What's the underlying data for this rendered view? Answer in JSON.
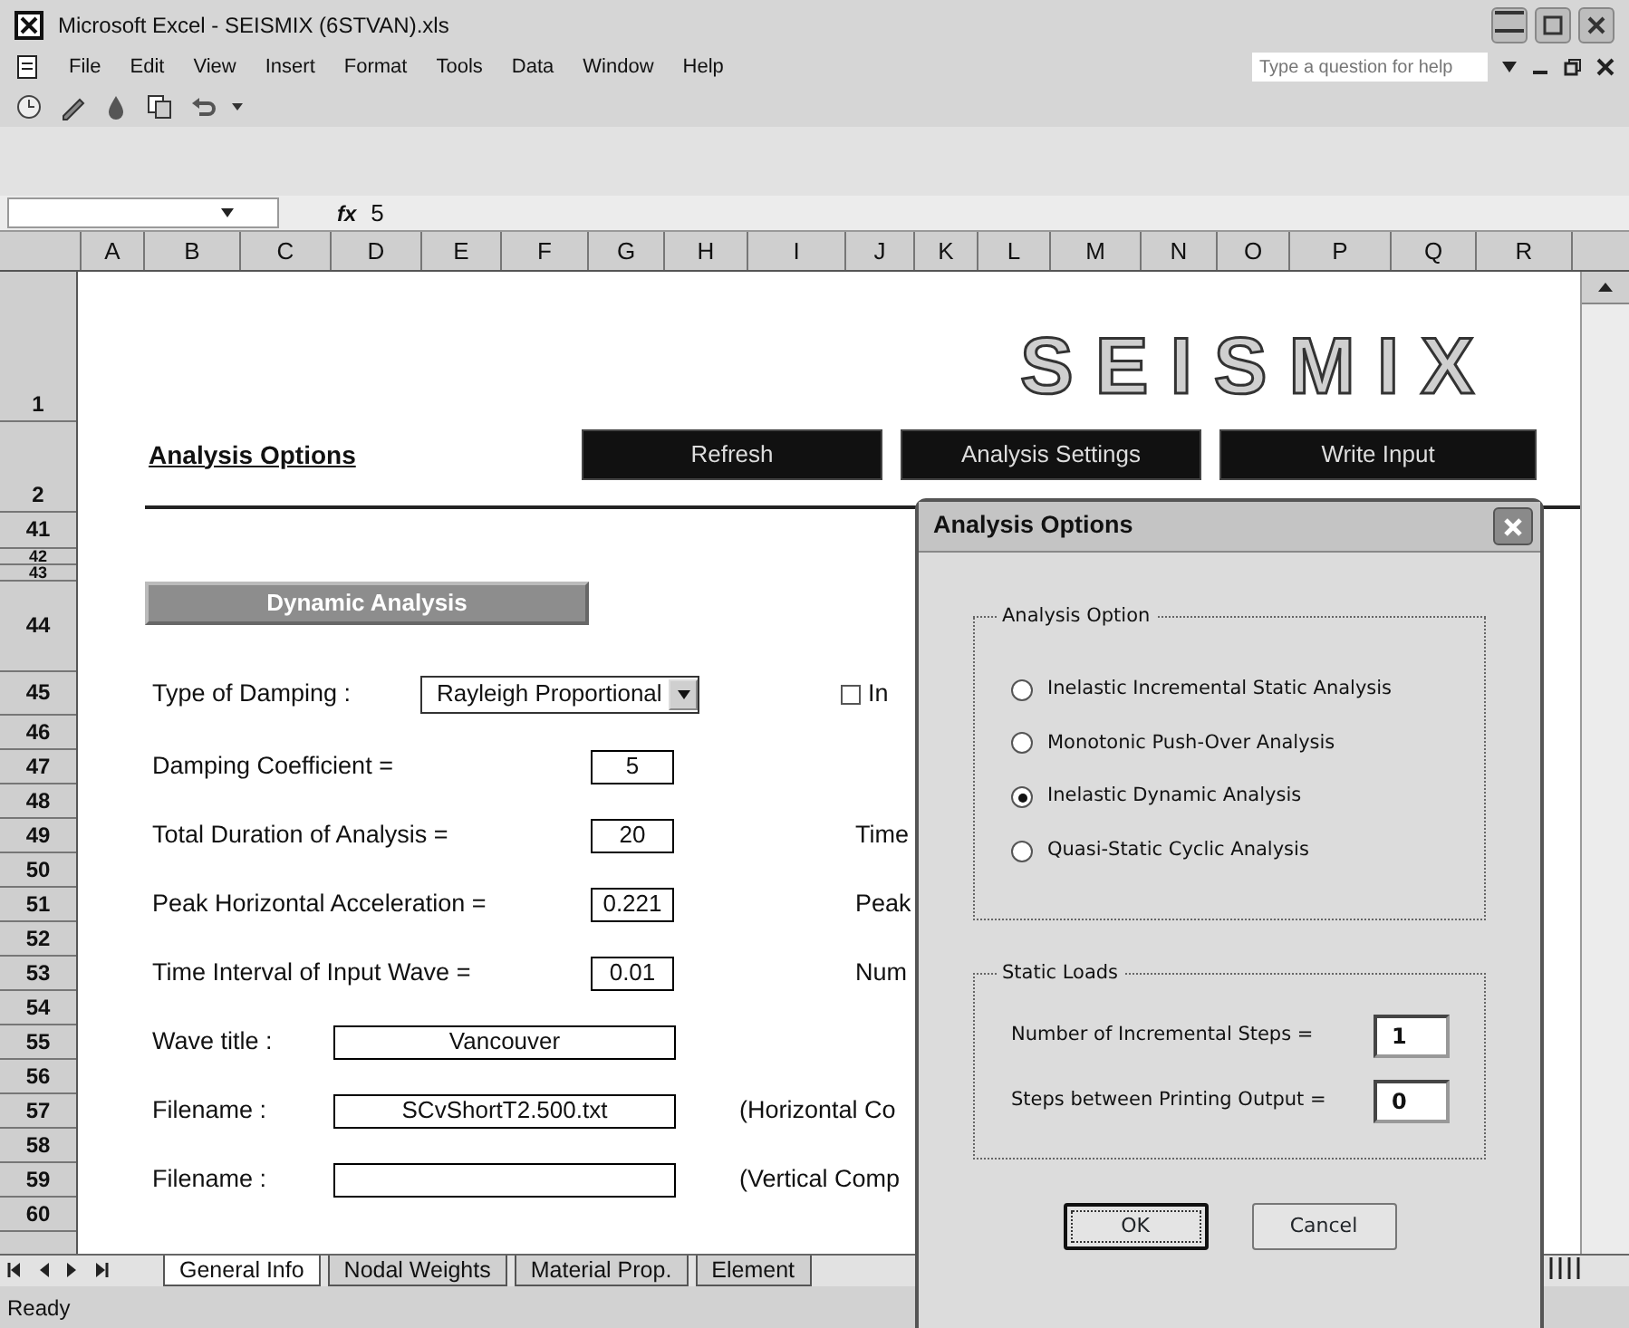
{
  "window": {
    "title": "Microsoft Excel - SEISMIX (6STVAN).xls"
  },
  "menu": [
    "File",
    "Edit",
    "View",
    "Insert",
    "Format",
    "Tools",
    "Data",
    "Window",
    "Help"
  ],
  "help_search": {
    "placeholder": "Type a question for help"
  },
  "formula_bar": {
    "fx": "fx",
    "value": "5"
  },
  "columns": [
    "A",
    "B",
    "C",
    "D",
    "E",
    "F",
    "G",
    "H",
    "I",
    "J",
    "K",
    "L",
    "M",
    "N",
    "O",
    "P",
    "Q",
    "R"
  ],
  "rows": [
    "1",
    "2",
    "41",
    "42",
    "43",
    "44",
    "45",
    "46",
    "47",
    "48",
    "49",
    "50",
    "51",
    "52",
    "53",
    "54",
    "55",
    "56",
    "57",
    "58",
    "59",
    "60"
  ],
  "sheet": {
    "logo": "SEISMIX",
    "heading": "Analysis Options",
    "buttons": [
      "Refresh",
      "Analysis Settings",
      "Write Input"
    ],
    "section_button": "Dynamic Analysis",
    "damping": {
      "label": "Type of Damping :",
      "value": "Rayleigh Proportional"
    },
    "checkbox": {
      "label": "In",
      "checked": false
    },
    "fields": [
      {
        "kind": "short",
        "label": "Damping Coefficient =",
        "value": "5"
      },
      {
        "kind": "short",
        "label": "Total Duration of Analysis =",
        "value": "20",
        "note": "Time"
      },
      {
        "kind": "short",
        "label": "Peak Horizontal Acceleration =",
        "value": "0.221",
        "note": "Peak"
      },
      {
        "kind": "short",
        "label": "Time Interval of Input Wave =",
        "value": "0.01",
        "note": "Num"
      },
      {
        "kind": "wide",
        "label": "Wave title :",
        "value": "Vancouver"
      },
      {
        "kind": "wide",
        "label": "Filename :",
        "value": "SCvShortT2.500.txt",
        "note": "(Horizontal Co"
      },
      {
        "kind": "wide",
        "label": "Filename :",
        "note": "(Vertical Comp"
      }
    ]
  },
  "sheet_tabs": [
    {
      "label": "General Info",
      "selected": true
    },
    {
      "label": "Nodal Weights",
      "selected": false
    },
    {
      "label": "Material Prop.",
      "selected": false
    },
    {
      "label": "Element",
      "selected": false
    }
  ],
  "status_bar": "Ready",
  "dialog": {
    "title": "Analysis Options",
    "option_group": {
      "title": "Analysis Option",
      "options": [
        {
          "label": "Inelastic Incremental Static Analysis",
          "selected": false
        },
        {
          "label": "Monotonic Push-Over Analysis",
          "selected": false
        },
        {
          "label": "Inelastic Dynamic Analysis",
          "selected": true
        },
        {
          "label": "Quasi-Static Cyclic Analysis",
          "selected": false
        }
      ]
    },
    "loads_group": {
      "title": "Static Loads",
      "fields": [
        {
          "label": "Number of Incremental Steps =",
          "value": "1"
        },
        {
          "label": "Steps between Printing Output =",
          "value": "0"
        }
      ]
    },
    "buttons": [
      {
        "label": "OK",
        "default": true
      },
      {
        "label": "Cancel",
        "default": false
      }
    ]
  }
}
